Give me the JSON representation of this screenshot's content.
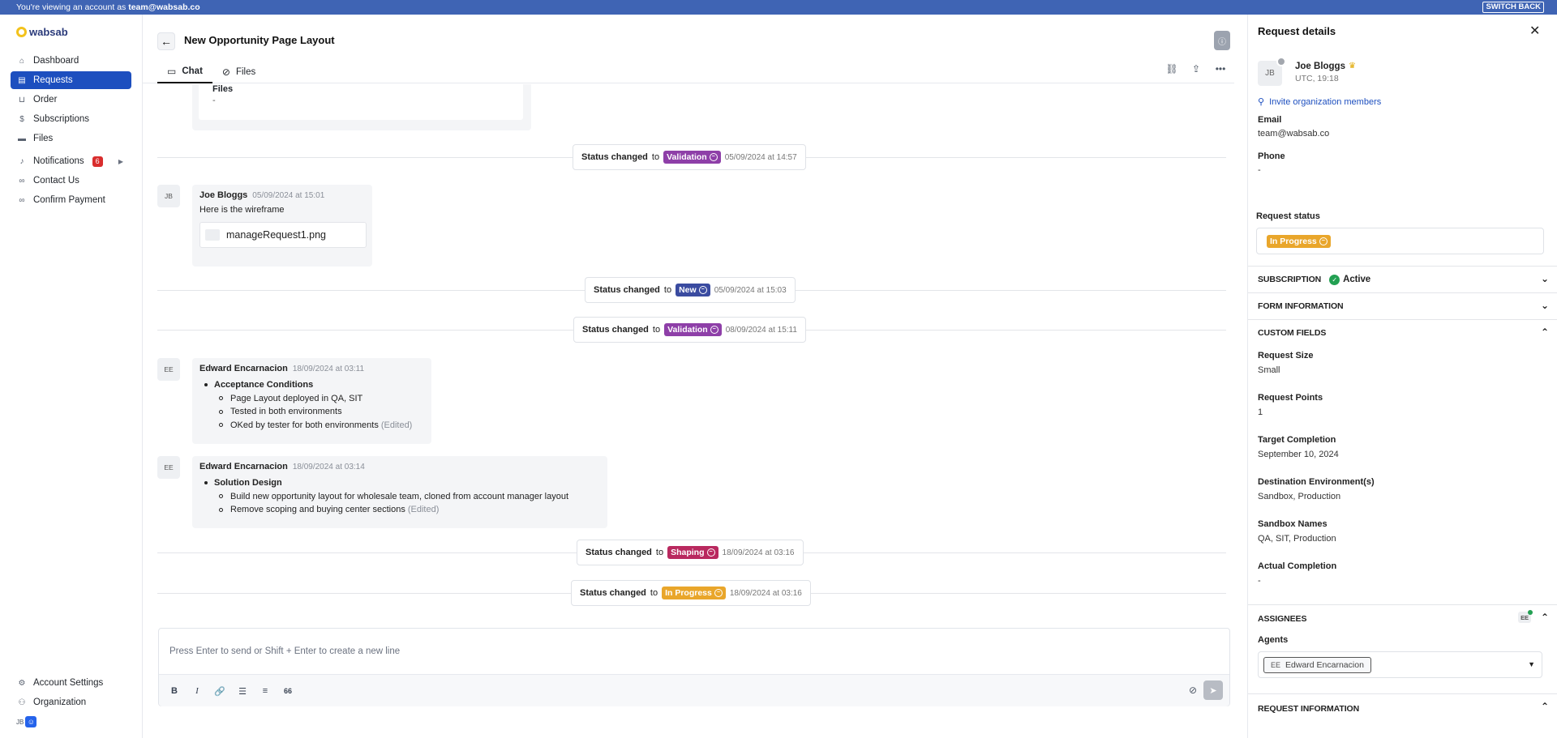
{
  "impersonation": {
    "prefix": "You're viewing an account as",
    "account": "team@wabsab.co",
    "switch_back": "SWITCH BACK"
  },
  "brand": {
    "name": "wabsab"
  },
  "sidebar": {
    "items": [
      {
        "label": "Dashboard",
        "icon": "home-icon"
      },
      {
        "label": "Requests",
        "icon": "requests-icon",
        "active": true
      },
      {
        "label": "Order",
        "icon": "basket-icon"
      },
      {
        "label": "Subscriptions",
        "icon": "dollar-icon"
      },
      {
        "label": "Files",
        "icon": "folder-icon"
      },
      {
        "label": "Notifications",
        "icon": "bell-icon",
        "badge": "6"
      },
      {
        "label": "Contact Us",
        "icon": "link-icon"
      },
      {
        "label": "Confirm Payment",
        "icon": "link-icon"
      }
    ],
    "bottom": [
      {
        "label": "Account Settings",
        "icon": "gear-icon"
      },
      {
        "label": "Organization",
        "icon": "people-icon"
      }
    ],
    "user_initials": "JB"
  },
  "header": {
    "title": "New Opportunity Page Layout",
    "tabs": [
      {
        "label": "Chat",
        "icon": "chat-icon",
        "active": true
      },
      {
        "label": "Files",
        "icon": "paperclip-icon"
      }
    ]
  },
  "chat": {
    "files_card": {
      "label": "Files",
      "value": "-"
    },
    "status_prefix": "Status changed",
    "status_to": "to",
    "status_events": [
      {
        "status": "Validation",
        "color": "#8e3fa8",
        "time": "05/09/2024 at 14:57"
      },
      {
        "status": "New",
        "color": "#3a4ba0",
        "time": "05/09/2024 at 15:03"
      },
      {
        "status": "Validation",
        "color": "#8e3fa8",
        "time": "08/09/2024 at 15:11"
      },
      {
        "status": "Shaping",
        "color": "#b9295f",
        "time": "18/09/2024 at 03:16"
      },
      {
        "status": "In Progress",
        "color": "#e9a62b",
        "time": "18/09/2024 at 03:16"
      }
    ],
    "messages": [
      {
        "initials": "JB",
        "author": "Joe Bloggs",
        "time": "05/09/2024 at 15:01",
        "text": "Here is the wireframe",
        "attachment": "manageRequest1.png"
      },
      {
        "initials": "EE",
        "author": "Edward Encarnacion",
        "time": "18/09/2024 at 03:11",
        "heading": "Acceptance Conditions",
        "bullets": [
          "Page Layout deployed in QA, SIT",
          "Tested in both environments",
          "OKed by tester for both environments"
        ],
        "edited": "(Edited)"
      },
      {
        "initials": "EE",
        "author": "Edward Encarnacion",
        "time": "18/09/2024 at 03:14",
        "heading": "Solution Design",
        "bullets": [
          "Build new opportunity layout for wholesale team, cloned from account manager layout",
          "Remove scoping and buying center sections"
        ],
        "edited": "(Edited)"
      }
    ]
  },
  "composer": {
    "placeholder": "Press Enter to send or Shift + Enter to create a new line",
    "tools": [
      {
        "name": "bold-icon",
        "glyph": "B"
      },
      {
        "name": "italic-icon",
        "glyph": "I"
      },
      {
        "name": "link-icon",
        "glyph": "🔗"
      },
      {
        "name": "bullet-list-icon",
        "glyph": "☰"
      },
      {
        "name": "numbered-list-icon",
        "glyph": "≡"
      },
      {
        "name": "quote-icon",
        "glyph": "66"
      }
    ]
  },
  "panel": {
    "title": "Request details",
    "user": {
      "initials": "JB",
      "name": "Joe Bloggs",
      "tz": "UTC, 19:18"
    },
    "invite": "Invite organization members",
    "email_label": "Email",
    "email": "team@wabsab.co",
    "phone_label": "Phone",
    "phone": "-",
    "status_label": "Request status",
    "status_value": "In Progress",
    "status_color": "#e9a62b",
    "sections": {
      "subscription": "SUBSCRIPTION",
      "subscription_status": "Active",
      "form_info": "FORM INFORMATION",
      "custom_fields": "CUSTOM FIELDS",
      "assignees": "ASSIGNEES",
      "request_info": "REQUEST INFORMATION"
    },
    "custom_fields": [
      {
        "label": "Request Size",
        "value": "Small"
      },
      {
        "label": "Request Points",
        "value": "1"
      },
      {
        "label": "Target Completion",
        "value": "September 10, 2024"
      },
      {
        "label": "Destination Environment(s)",
        "value": "Sandbox, Production"
      },
      {
        "label": "Sandbox Names",
        "value": "QA, SIT, Production"
      },
      {
        "label": "Actual Completion",
        "value": "-"
      }
    ],
    "assignee_initials": "EE",
    "agents_label": "Agents",
    "agent": {
      "initials": "EE",
      "name": "Edward Encarnacion"
    }
  }
}
